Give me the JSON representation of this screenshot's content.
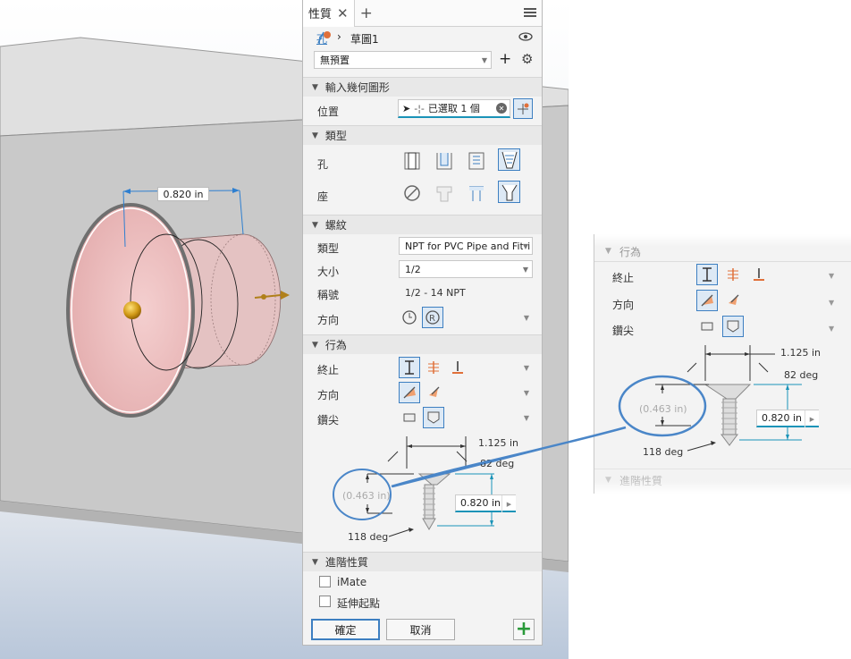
{
  "viewport": {
    "dimension_label": "0.820 in"
  },
  "panel": {
    "tab_title": "性質",
    "feature_name": "孔",
    "sketch_name": "草圖1",
    "preset_value": "無預置",
    "sections": {
      "input_geometry": {
        "title": "輸入幾何圖形",
        "position_label": "位置",
        "selection_text": "已選取 1 個"
      },
      "type": {
        "title": "類型",
        "hole_label": "孔",
        "seat_label": "座"
      },
      "thread": {
        "title": "螺紋",
        "type_label": "類型",
        "type_value": "NPT for PVC Pipe and Fitti",
        "size_label": "大小",
        "size_value": "1/2",
        "designation_label": "稱號",
        "designation_value": "1/2 - 14 NPT",
        "direction_label": "方向"
      },
      "behavior": {
        "title": "行為",
        "termination_label": "終止",
        "direction_label": "方向",
        "drill_point_label": "鑽尖",
        "dim_diameter": "1.125 in",
        "dim_angle": "82 deg",
        "dim_depth_ref": "(0.463 in)",
        "dim_depth": "0.820 in",
        "dim_drill_angle": "118 deg"
      },
      "advanced": {
        "title": "進階性質",
        "imate_label": "iMate",
        "extend_start_label": "延伸起點"
      }
    },
    "ok_label": "確定",
    "cancel_label": "取消"
  },
  "callout": {
    "section_title": "行為",
    "termination_label": "終止",
    "direction_label": "方向",
    "drill_point_label": "鑽尖",
    "dim_diameter": "1.125 in",
    "dim_angle": "82 deg",
    "dim_depth_ref": "(0.463 in)",
    "dim_depth": "0.820 in",
    "dim_drill_angle": "118 deg",
    "advanced_title": "進階性質"
  },
  "colors": {
    "accent_blue": "#3d7fc1",
    "dimension_teal": "#1a93b8",
    "callout_blue": "#4a86c8",
    "hole_pink": "#e8b4b4",
    "viewport_gray": "#c6c6c6"
  }
}
